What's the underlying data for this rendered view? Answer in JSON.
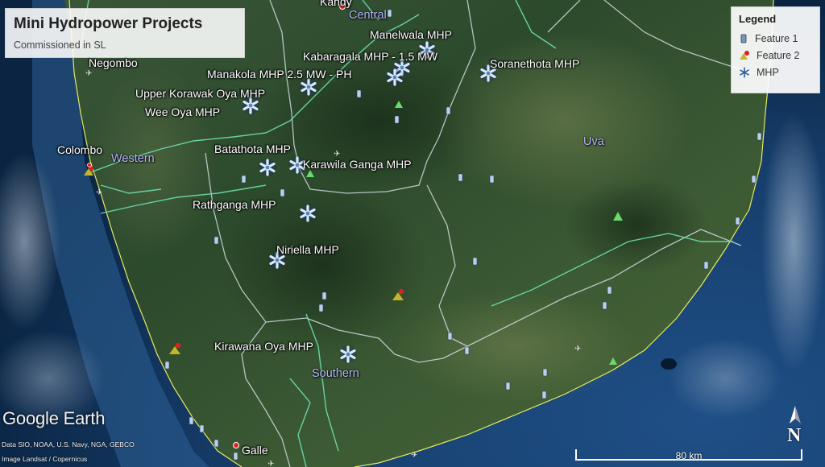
{
  "panel": {
    "title": "Mini Hydropower Projects",
    "subtitle": "Commissioned in SL"
  },
  "legend": {
    "title": "Legend",
    "items": [
      {
        "label": "Feature 1",
        "icon": "well-icon"
      },
      {
        "label": "Feature 2",
        "icon": "mountain-pin-icon"
      },
      {
        "label": "MHP",
        "icon": "snowflake-icon"
      }
    ]
  },
  "places": {
    "kandy": "Kandy",
    "negombo": "Negombo",
    "colombo": "Colombo",
    "galle": "Galle"
  },
  "regions": {
    "central": "Central",
    "western": "Western",
    "uva": "Uva",
    "southern": "Southern"
  },
  "mhp": {
    "manelwala": "Manelwala MHP",
    "kabaragala": "Kabaragala MHP - 1.5 MW",
    "soranethota": "Soranethota MHP",
    "manakola": "Manakola MHP 2.5 MW - PH",
    "upper_korawak": "Upper Korawak Oya MHP",
    "wee_oya": "Wee Oya MHP",
    "batathota": "Batathota MHP",
    "karawila": "Karawila Ganga MHP",
    "rathganga": "Rathganga MHP",
    "niriella": "Niriella MHP",
    "kirawana": "Kirawana Oya MHP"
  },
  "scale": {
    "label": "80 km"
  },
  "north": {
    "label": "N"
  },
  "brand": {
    "name": "Google Earth"
  },
  "credits": {
    "line1": "Data SIO, NOAA, U.S. Navy, NGA, GEBCO",
    "line2": "Image Landsat / Copernicus"
  },
  "colors": {
    "ocean_deep": "#0d2a4d",
    "ocean_shelf": "#2c5b8f",
    "land_dark": "#233c23",
    "land_mid": "#3d5a33",
    "boundary": "#c8d4d8",
    "road": "#6ce0b0",
    "coast": "#e6ea60",
    "mhp_icon": "#9fc8ff",
    "feature2_red": "#e02020"
  }
}
